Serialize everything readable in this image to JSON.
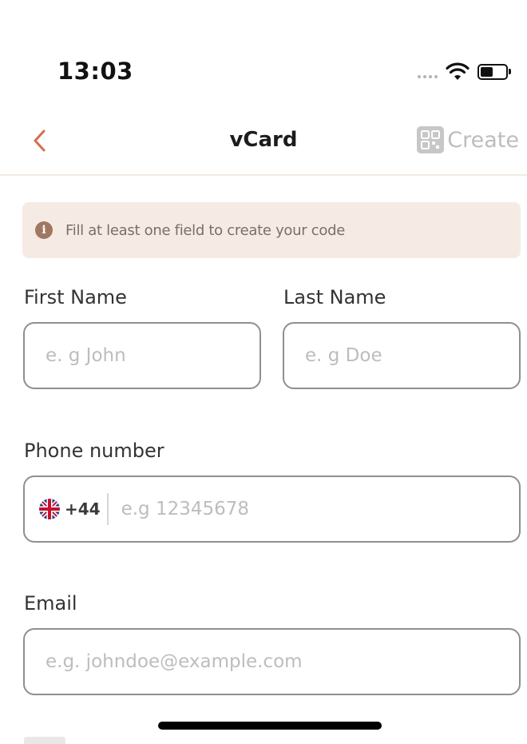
{
  "status_bar": {
    "time": "13:03",
    "icons": [
      "signal-dots-icon",
      "wifi-icon",
      "battery-icon"
    ]
  },
  "nav": {
    "back_icon": "chevron-left-icon",
    "title": "vCard",
    "create_label": "Create",
    "create_icon": "qr-code-icon"
  },
  "banner": {
    "icon": "info-icon",
    "icon_glyph": "i",
    "text": "Fill at least one field to create your code"
  },
  "form": {
    "first_name": {
      "label": "First Name",
      "placeholder": "e. g John",
      "value": ""
    },
    "last_name": {
      "label": "Last Name",
      "placeholder": "e. g Doe",
      "value": ""
    },
    "phone": {
      "label": "Phone number",
      "country_flag": "uk-flag-icon",
      "dial_code": "+44",
      "placeholder": "e.g 12345678",
      "value": ""
    },
    "email": {
      "label": "Email",
      "placeholder": "e.g. johndoe@example.com",
      "value": ""
    }
  },
  "colors": {
    "accent": "#d2704a",
    "banner_bg": "#f6ebe4",
    "disabled": "#bdbdbd",
    "input_border": "#8f8f8f"
  }
}
